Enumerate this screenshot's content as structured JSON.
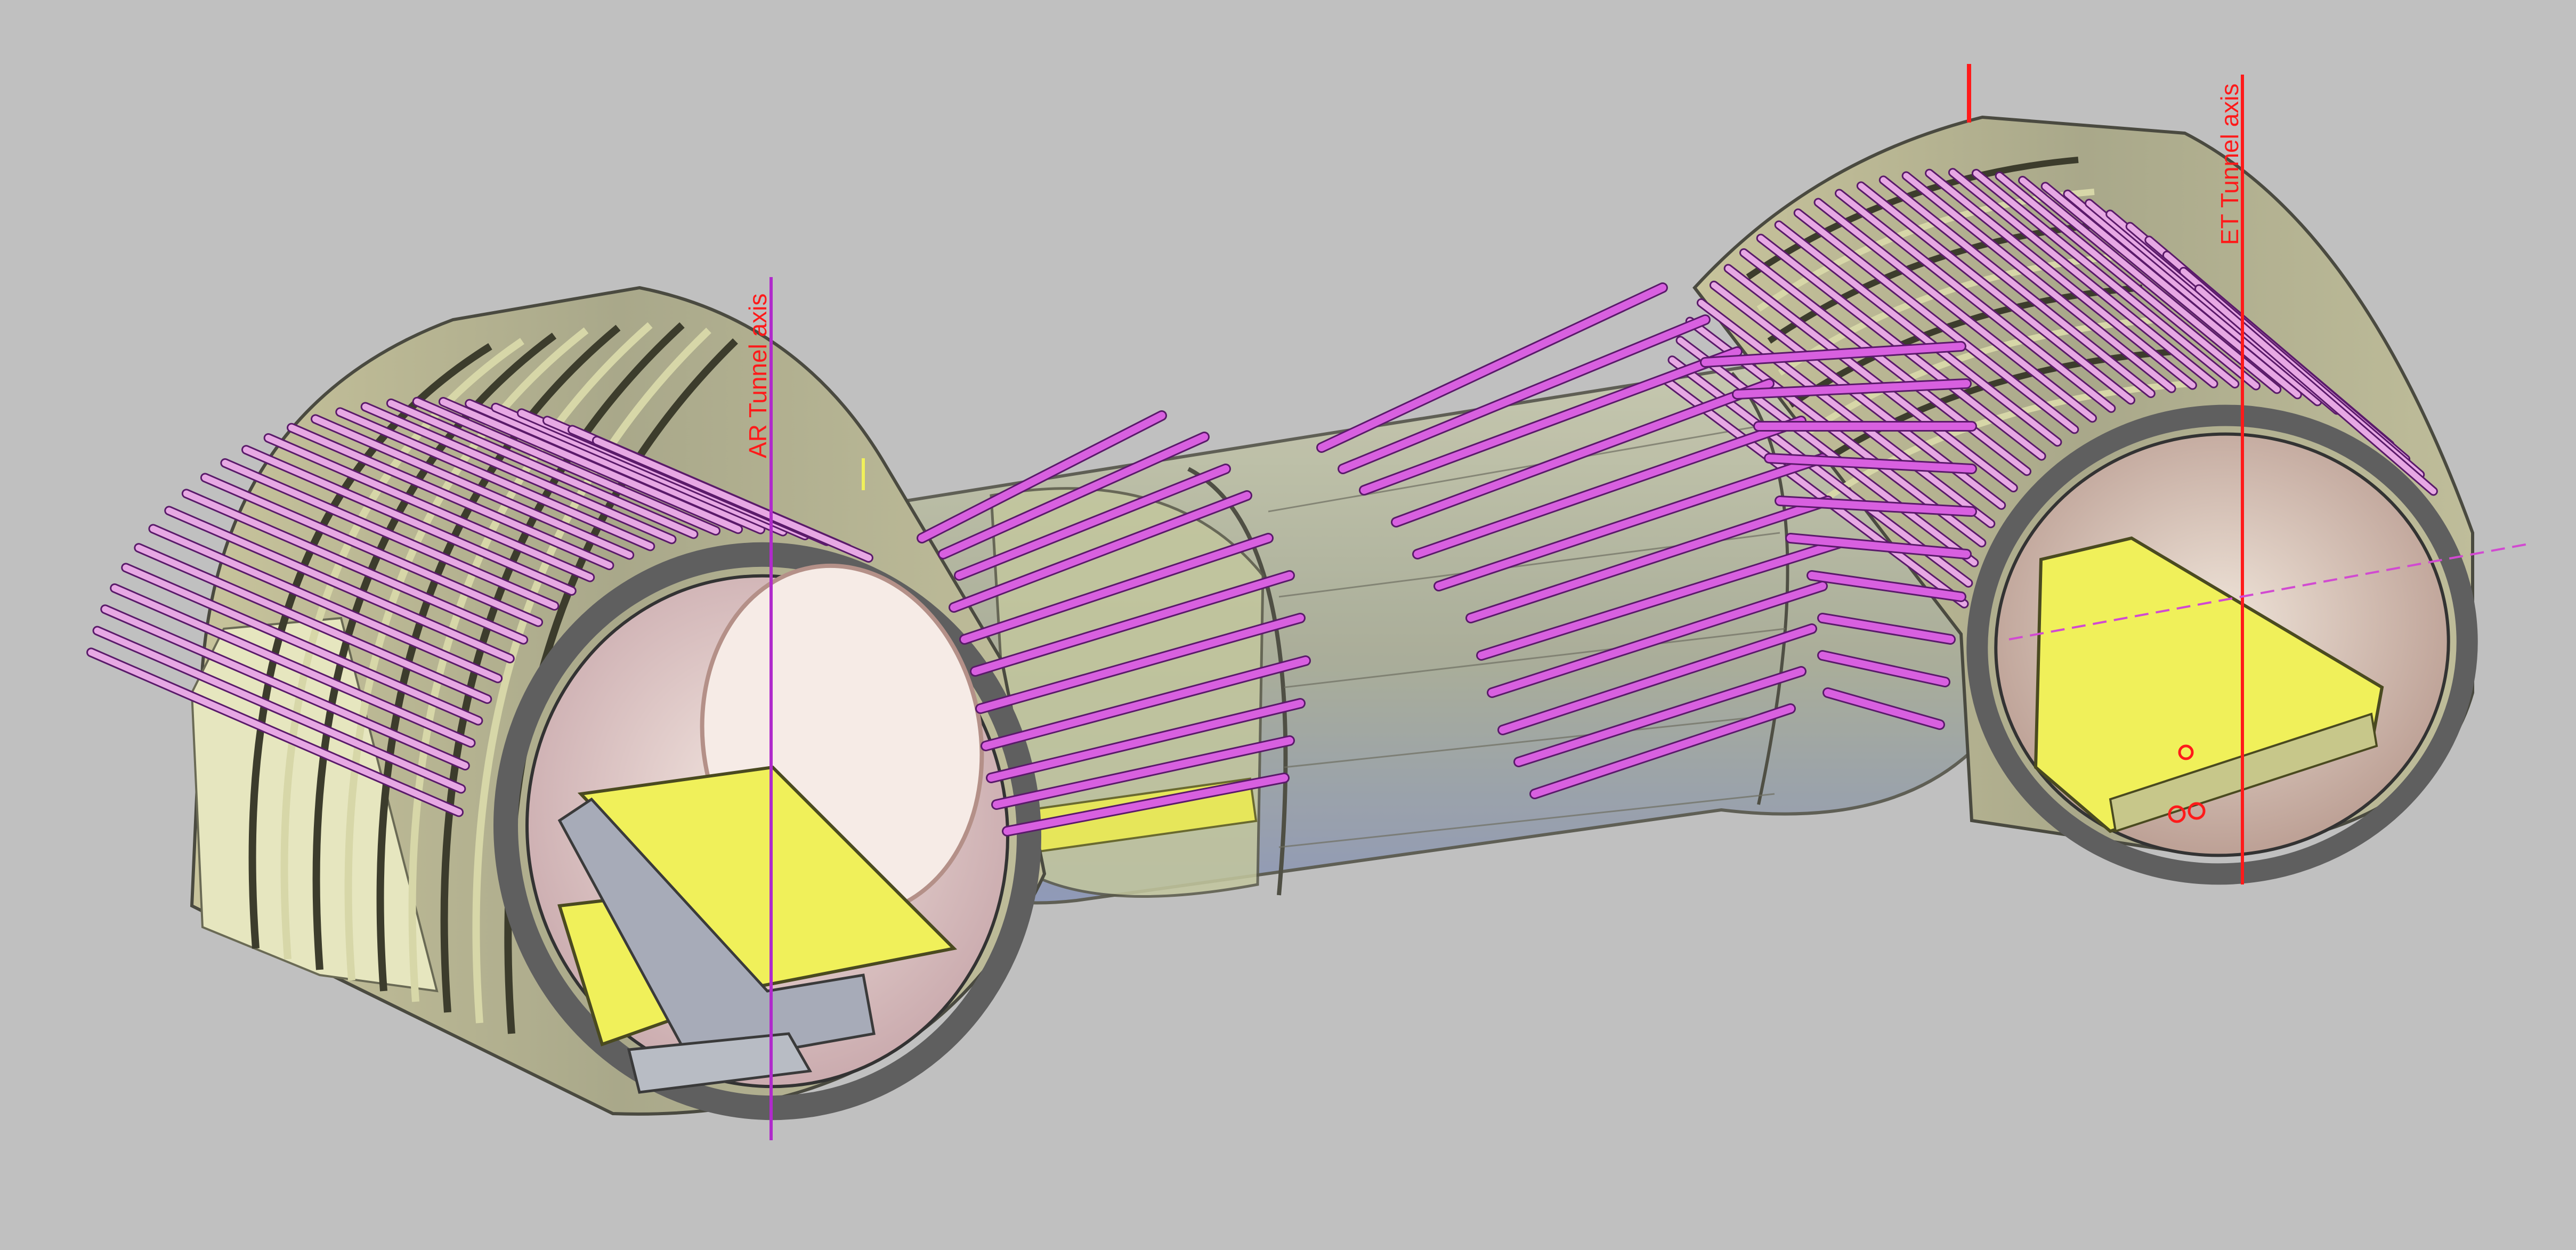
{
  "viewport": {
    "background": "#c0c0c0"
  },
  "labels": {
    "left_axis": "AR Tunnel axis",
    "right_axis": "ET Tunnel axis"
  },
  "colors": {
    "bolt": "#d860e0",
    "bolt_outline": "#5a1a6a",
    "bolt_light": "#e7a8e4",
    "rib": "#d7d7a8",
    "rib_dark": "#3c3c2c",
    "lining": "#5f5f5f",
    "slab": "#f0f05a",
    "axis_red": "#ff1a1a",
    "axis_magenta": "#b02acc",
    "inner_pink": "#d7b6b8",
    "cavern": "#a8ae9c"
  }
}
